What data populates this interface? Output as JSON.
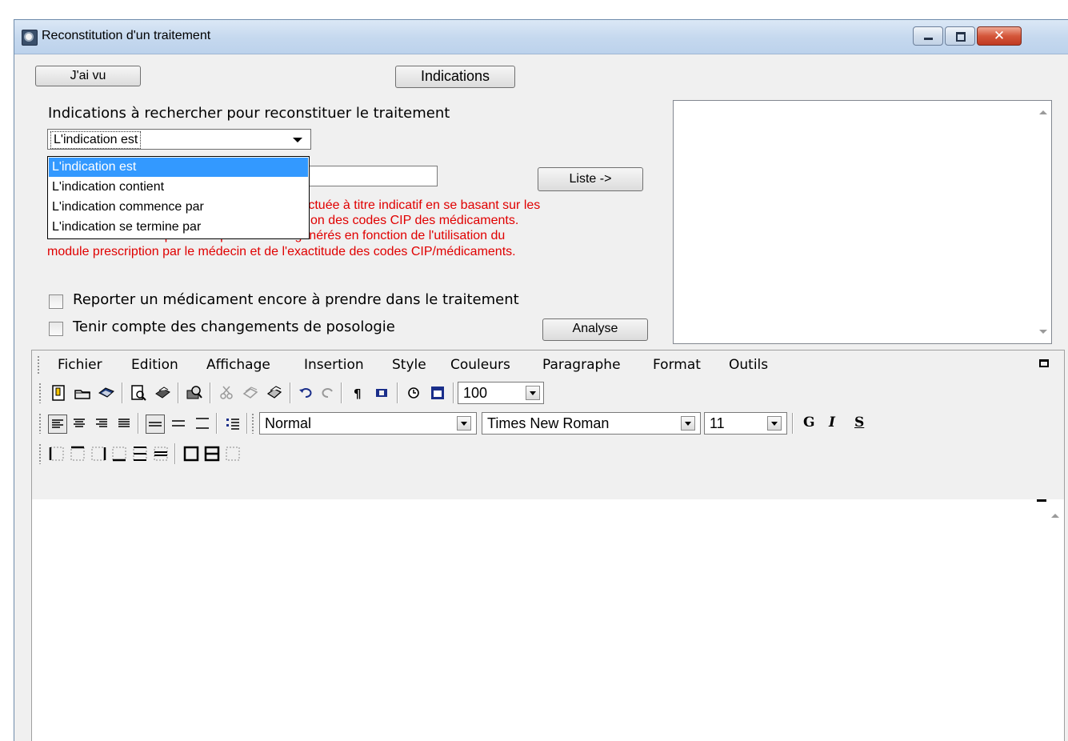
{
  "window": {
    "title": "Reconstitution d'un traitement",
    "close_glyph": "✕"
  },
  "top_buttons": {
    "seen": "J'ai vu",
    "indications": "Indications"
  },
  "search": {
    "label": "Indications à rechercher pour reconstituer le traitement",
    "mode_selected": "L'indication est",
    "mode_options": [
      "L'indication est",
      "L'indication contient",
      "L'indication commence par",
      "L'indication se termine par"
    ],
    "input_value": "",
    "list_button": "Liste ->"
  },
  "warning": {
    "line1": "fectuée à titre indicatif en se basant sur les",
    "line2": "ction des codes CIP des médicaments.",
    "line3": "Des erreurs ou manquements peuvent être générés en fonction de l'utilisation du",
    "line4": "module prescription par le médecin et de l'exactitude des codes CIP/médicaments."
  },
  "options": {
    "report_label": "Reporter un médicament encore à prendre dans le traitement",
    "report_checked": false,
    "dosage_label": "Tenir compte des changements de posologie",
    "dosage_checked": false,
    "analyse_button": "Analyse"
  },
  "editor": {
    "menu": [
      "Fichier",
      "Edition",
      "Affichage",
      "Insertion",
      "Style",
      "Couleurs",
      "Paragraphe",
      "Format",
      "Outils"
    ],
    "zoom": "100",
    "paragraph_style": "Normal",
    "font": "Times New Roman",
    "font_size": "11",
    "bold_label": "G",
    "italic_label": "I",
    "underline_label": "S",
    "pilcrow": "¶",
    "icons": {
      "row1": [
        "new-doc-icon",
        "open-folder-icon",
        "save-disk-icon",
        "print-preview-icon",
        "print-icon",
        "find-icon",
        "cut-icon",
        "copy-icon",
        "paste-icon",
        "undo-icon",
        "redo-icon",
        "pilcrow-icon",
        "field-icon",
        "clock-icon",
        "calendar-icon"
      ],
      "row2": [
        "align-left-icon",
        "align-center-icon",
        "align-right-icon",
        "justify-icon",
        "line-spacing-1-icon",
        "line-spacing-1-5-icon",
        "line-spacing-2-icon",
        "bullet-list-icon"
      ],
      "row3": [
        "border-left-icon",
        "border-top-icon",
        "border-right-icon",
        "border-bottom-icon",
        "border-horizontal-icon",
        "border-inner-icon",
        "border-outside-icon",
        "border-all-icon",
        "border-none-icon"
      ]
    }
  }
}
